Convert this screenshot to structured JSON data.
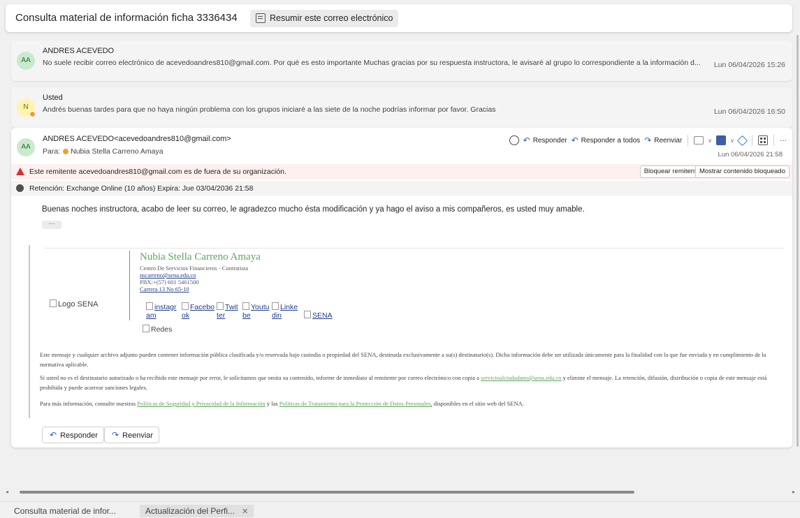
{
  "subject": {
    "title": "Consulta material de información ficha 3336434",
    "summarize_label": "Resumir este correo electrónico"
  },
  "thread": [
    {
      "initials": "AA",
      "sender": "ANDRES ACEVEDO",
      "preview": "No suele recibir correo electrónico de acevedoandres810@gmail.com. Por qué es esto importante Muchas gracias por su respuesta instructora, le avisaré al grupo lo correspondiente a la información d...",
      "date": "Lun 06/04/2026 15:26"
    },
    {
      "initials": "N",
      "sender": "Usted",
      "preview": "Andrés buenas tardes para que no haya ningún problema con los grupos iniciaré a las siete de la noche podrías informar por favor. Gracias",
      "date": "Lun 06/04/2026 16:50"
    }
  ],
  "message": {
    "initials": "AA",
    "sender": "ANDRES ACEVEDO<acevedoandres810@gmail.com>",
    "to_label": "Para:",
    "to_name": "Nubia Stella Carreno Amaya",
    "date": "Lun 06/04/2026 21:58",
    "actions": {
      "reply": "Responder",
      "reply_all": "Responder a todos",
      "forward": "Reenviar",
      "more": "···"
    },
    "warning": {
      "text": "Este remitente acevedoandres810@gmail.com es de fuera de su organización.",
      "block_label": "Bloquear remitente",
      "show_blocked_label": "Mostrar contenido bloqueado"
    },
    "retention": "Retención: Exchange Online (10 años) Expira: Jue 03/04/2036 21:58",
    "body": "Buenas noches instructora, acabo de leer su correo, le agradezco mucho ésta modificación y ya hago el aviso a mis compañeros, es usted muy amable.",
    "ellipsis": "···",
    "signature": {
      "logo_alt": "Logo SENA",
      "name": "Nubia Stella Carreno Amaya",
      "role": "Centro De Servicios Financieros - Contratista",
      "email": "nscarreno@sena.edu.co",
      "phone": "PBX:+(57) 601 5461500",
      "address": "Carrera 13 No 65-10",
      "social": [
        {
          "line1": "instagr",
          "line2": "am"
        },
        {
          "line1": "Facebo",
          "line2": "ok"
        },
        {
          "line1": "Twit",
          "line2": "ter"
        },
        {
          "line1": "Youtu",
          "line2": "be"
        },
        {
          "line1": "Linke",
          "line2": "din"
        }
      ],
      "sena_alt": "SENA",
      "redes_alt": "Redes"
    },
    "disclaimer": {
      "p1": "Este mensaje y cualquier archivo adjunto pueden contener información pública clasificada y/o reservada bajo custodia o propiedad del SENA, destinada exclusivamente a su(s) destinatario(s). Dicha información debe ser utilizada únicamente para la finalidad con la que fue enviada y en cumplimiento de la normativa aplicable.",
      "p2a": "Si usted no es el destinatario autorizado o ha recibido este mensaje por error, le solicitamos que omita su contenido, informe de inmediato al remitente por correo electrónico con copia a",
      "p2_link": "servicioalciudadano@sena.edu.co",
      "p2b": "y elimine el mensaje. La retención, difusión, distribución o copia de este mensaje está prohibida y puede acarrear sanciones legales.",
      "p3a": "Para más información, consulte nuestras",
      "p3_link1": "Políticas de Seguridad y Privacidad de la Información",
      "p3b": "y las",
      "p3_link2": "Políticas de Tratamiento para la Protección de Datos Personales,",
      "p3c": "disponibles en el sitio web del SENA."
    },
    "footer_reply": "Responder",
    "footer_forward": "Reenviar"
  },
  "tabs": [
    {
      "label": "Consulta material de infor..."
    },
    {
      "label": "Actualización del Perfi..."
    }
  ],
  "colors": {
    "accent": "#2b62b5",
    "warning": "#d13438",
    "signature_green": "#5aa85a"
  }
}
